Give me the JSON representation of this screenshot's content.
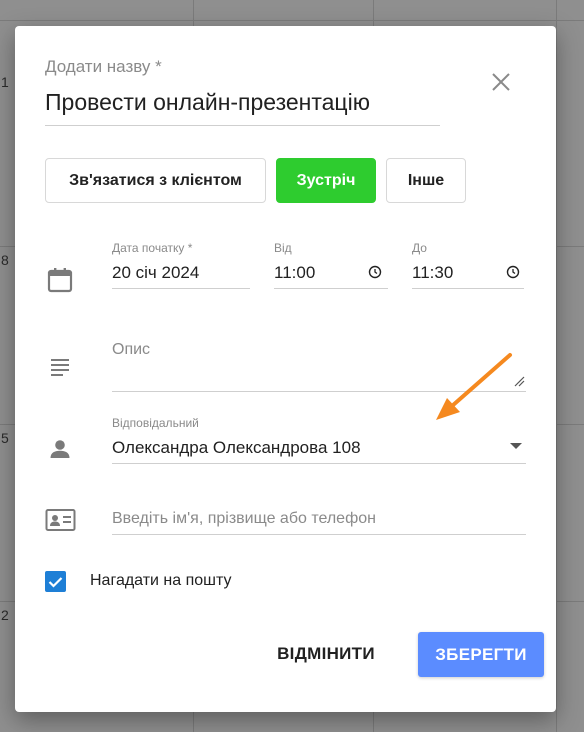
{
  "calendar_background": {
    "day_numbers": [
      "1",
      "8",
      "5",
      "2"
    ]
  },
  "dialog": {
    "title_label": "Додати назву *",
    "title_value": "Провести онлайн-презентацію",
    "type_buttons": [
      {
        "label": "Зв'язатися з клієнтом",
        "active": false
      },
      {
        "label": "Зустріч",
        "active": true
      },
      {
        "label": "Інше",
        "active": false
      }
    ],
    "active_color": "#2ecc2f",
    "date": {
      "start_label": "Дата початку *",
      "start_value": "20 січ 2024",
      "from_label": "Від",
      "from_value": "11:00",
      "to_label": "До",
      "to_value": "11:30"
    },
    "description": {
      "placeholder": "Опис"
    },
    "responsible": {
      "label": "Відповідальний",
      "value": "Олександра Олександрова 108"
    },
    "contact": {
      "placeholder": "Введіть ім'я, прізвище або телефон"
    },
    "remind": {
      "label": "Нагадати на пошту",
      "checked": true
    },
    "actions": {
      "cancel_label": "ВІДМІНИТИ",
      "save_label": "ЗБЕРЕГТИ",
      "save_color": "#5b8cff"
    }
  },
  "annotation": {
    "arrow_color": "#f5891f"
  }
}
